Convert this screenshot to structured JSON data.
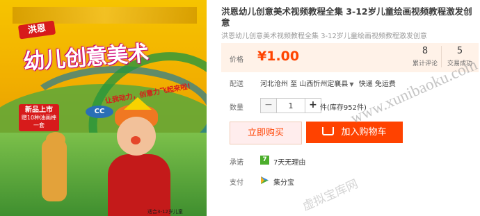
{
  "product_image": {
    "brand_logo": "洪恩",
    "title": "幼儿创意美术",
    "slogan": "让我动力，创意力飞起来啦!",
    "badge_line1": "新品上市",
    "badge_line2": "赠10种油画棒一套",
    "publisher_logo": "CC",
    "footer": "适合3-12岁儿童"
  },
  "product": {
    "title": "洪恩幼儿创意美术视频教程全集 3-12岁儿童绘画视频教程激发创意",
    "subtitle": "洪恩幼儿创意美术视频教程全集 3-12岁儿童绘画视频教程激发创意"
  },
  "price": {
    "label": "价格",
    "value": "¥1.00",
    "reviews_count": "8",
    "reviews_label": "累计评论",
    "sales_count": "5",
    "sales_label": "交易成功"
  },
  "shipping": {
    "label": "配送",
    "from": "河北沧州",
    "to_word": "至",
    "destination": "山西忻州定襄县",
    "method": "快递 免运费"
  },
  "quantity": {
    "label": "数量",
    "value": "1",
    "minus": "−",
    "plus": "+",
    "stock_text": "件(库存952件)"
  },
  "actions": {
    "buy_now": "立即购买",
    "add_to_cart": "加入购物车"
  },
  "promise": {
    "label": "承诺",
    "icon_text": "7",
    "text": "7天无理由"
  },
  "payment": {
    "label": "支付",
    "text": "集分宝"
  },
  "watermark": {
    "url": "www.xunibaoku.com",
    "cn": "虚拟宝库网"
  },
  "colors": {
    "price": "#ff4400",
    "add_cart_bg": "#ff4200",
    "price_box_bg": "#fff2e8",
    "promise_icon": "#4cae2c"
  },
  "icons": [
    "cart-icon",
    "seven-day-return-icon",
    "payment-icon",
    "caret-down-icon"
  ]
}
